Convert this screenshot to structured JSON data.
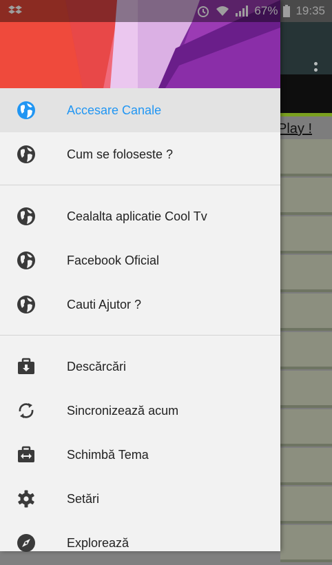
{
  "status_bar": {
    "battery_percent": "67%",
    "time": "19:35"
  },
  "background_app": {
    "link_text": "Play !"
  },
  "drawer": {
    "colors": {
      "accent": "#2196F3",
      "text": "#222222",
      "background": "#f2f2f2",
      "active_bg": "#e3e3e3"
    },
    "group1": [
      {
        "label": "Accesare Canale",
        "icon": "globe-icon",
        "active": true
      },
      {
        "label": "Cum se foloseste ?",
        "icon": "globe-icon"
      }
    ],
    "group2": [
      {
        "label": "Cealalta aplicatie Cool Tv",
        "icon": "globe-icon"
      },
      {
        "label": "Facebook Oficial",
        "icon": "globe-icon"
      },
      {
        "label": "Cauti Ajutor ?",
        "icon": "globe-icon"
      }
    ],
    "group3": [
      {
        "label": "Descărcări",
        "icon": "download-icon"
      },
      {
        "label": "Sincronizează acum",
        "icon": "sync-icon"
      },
      {
        "label": "Schimbă Tema",
        "icon": "switch-theme-icon"
      },
      {
        "label": "Setări",
        "icon": "settings-icon"
      },
      {
        "label": "Explorează",
        "icon": "explore-icon"
      }
    ]
  }
}
